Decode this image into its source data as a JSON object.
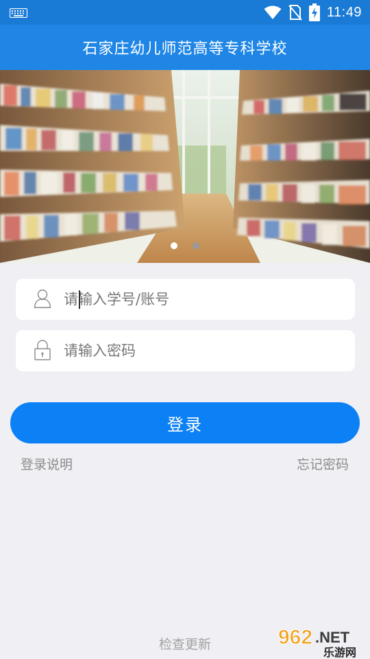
{
  "status_bar": {
    "time": "11:49",
    "icons": [
      "keyboard-icon",
      "wifi-icon",
      "no-sim-icon",
      "battery-charging-icon"
    ]
  },
  "header": {
    "title": "石家庄幼儿师范高等专科学校"
  },
  "banner": {
    "slides_count": 2,
    "active_slide": 1
  },
  "login_form": {
    "account_placeholder": "请输入学号/账号",
    "password_placeholder": "请输入密码",
    "account_icon": "user-icon",
    "password_icon": "lock-icon",
    "login_label": "登录"
  },
  "links": {
    "login_help": "登录说明",
    "forgot_password": "忘记密码",
    "check_update": "检查更新"
  },
  "watermark": {
    "brand_number": "962",
    "brand_suffix": ".NET",
    "brand_name": "乐游网"
  },
  "colors": {
    "status_bar": "#1a7bd6",
    "title_bar": "#1f86e6",
    "primary_button": "#0c80f5",
    "background": "#efeff4",
    "link_text": "#8c8c8c"
  }
}
